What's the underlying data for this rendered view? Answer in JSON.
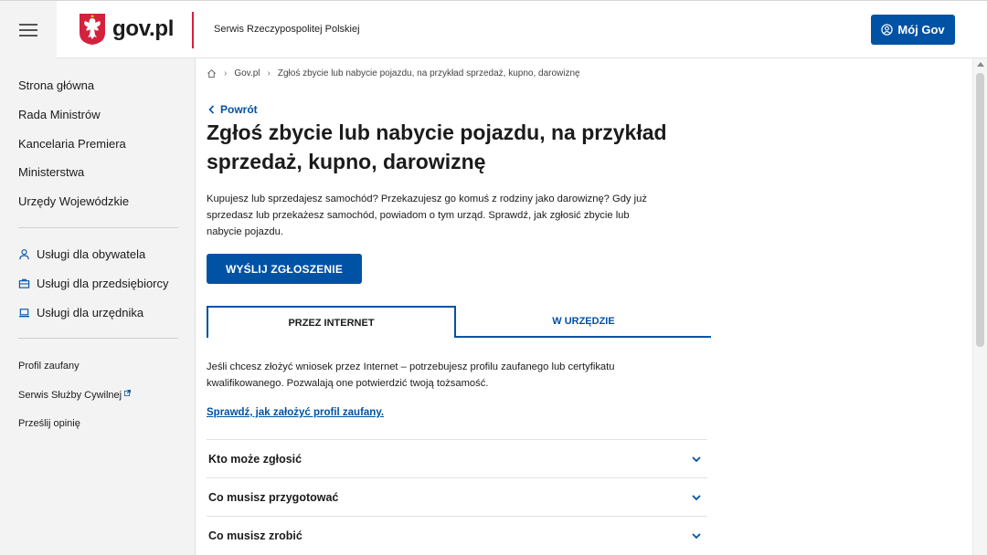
{
  "header": {
    "logo_text": "gov.pl",
    "service_name": "Serwis Rzeczypospolitej Polskiej",
    "account_button": "Mój Gov",
    "brand_color": "#0052a5",
    "accent_red": "#d4213d"
  },
  "sidebar": {
    "main_links": [
      "Strona główna",
      "Rada Ministrów",
      "Kancelaria Premiera",
      "Ministerstwa",
      "Urzędy Wojewódzkie"
    ],
    "service_links": [
      {
        "label": "Usługi dla obywatela",
        "icon": "person-icon"
      },
      {
        "label": "Usługi dla przedsiębiorcy",
        "icon": "briefcase-icon"
      },
      {
        "label": "Usługi dla urzędnika",
        "icon": "laptop-icon"
      }
    ],
    "footer_links": [
      "Profil zaufany",
      "Serwis Służby Cywilnej",
      "Prześlij opinię"
    ]
  },
  "breadcrumb": {
    "items": [
      "Gov.pl",
      "Zgłoś zbycie lub nabycie pojazdu, na przykład sprzedaż, kupno, darowiznę"
    ]
  },
  "main": {
    "back_label": "Powrót",
    "title_line1": "Zgłoś zbycie lub nabycie pojazdu, na przykład",
    "title_line2": "sprzedaż, kupno, darowiznę",
    "intro_line1": "Kupujesz lub sprzedajesz samochód? Przekazujesz go komuś z rodziny jako darowiznę? Gdy już",
    "intro_line2": "sprzedasz lub przekażesz samochód, powiadom o tym urząd. Sprawdź, jak zgłosić zbycie lub",
    "intro_line3": "nabycie pojazdu.",
    "primary_button": "WYŚLIJ ZGŁOSZENIE",
    "tabs": [
      {
        "label": "PRZEZ INTERNET",
        "active": true
      },
      {
        "label": "W URZĘDZIE",
        "active": false
      }
    ],
    "tab_text_line1": "Jeśli chcesz złożyć wniosek przez Internet – potrzebujesz profilu zaufanego lub certyfikatu",
    "tab_text_line2": "kwalifikowanego. Pozwalają one potwierdzić twoją tożsamość.",
    "tab_link": "Sprawdź, jak założyć profil zaufany.",
    "accordion": [
      "Kto może zgłosić",
      "Co musisz przygotować",
      "Co musisz zrobić"
    ]
  }
}
